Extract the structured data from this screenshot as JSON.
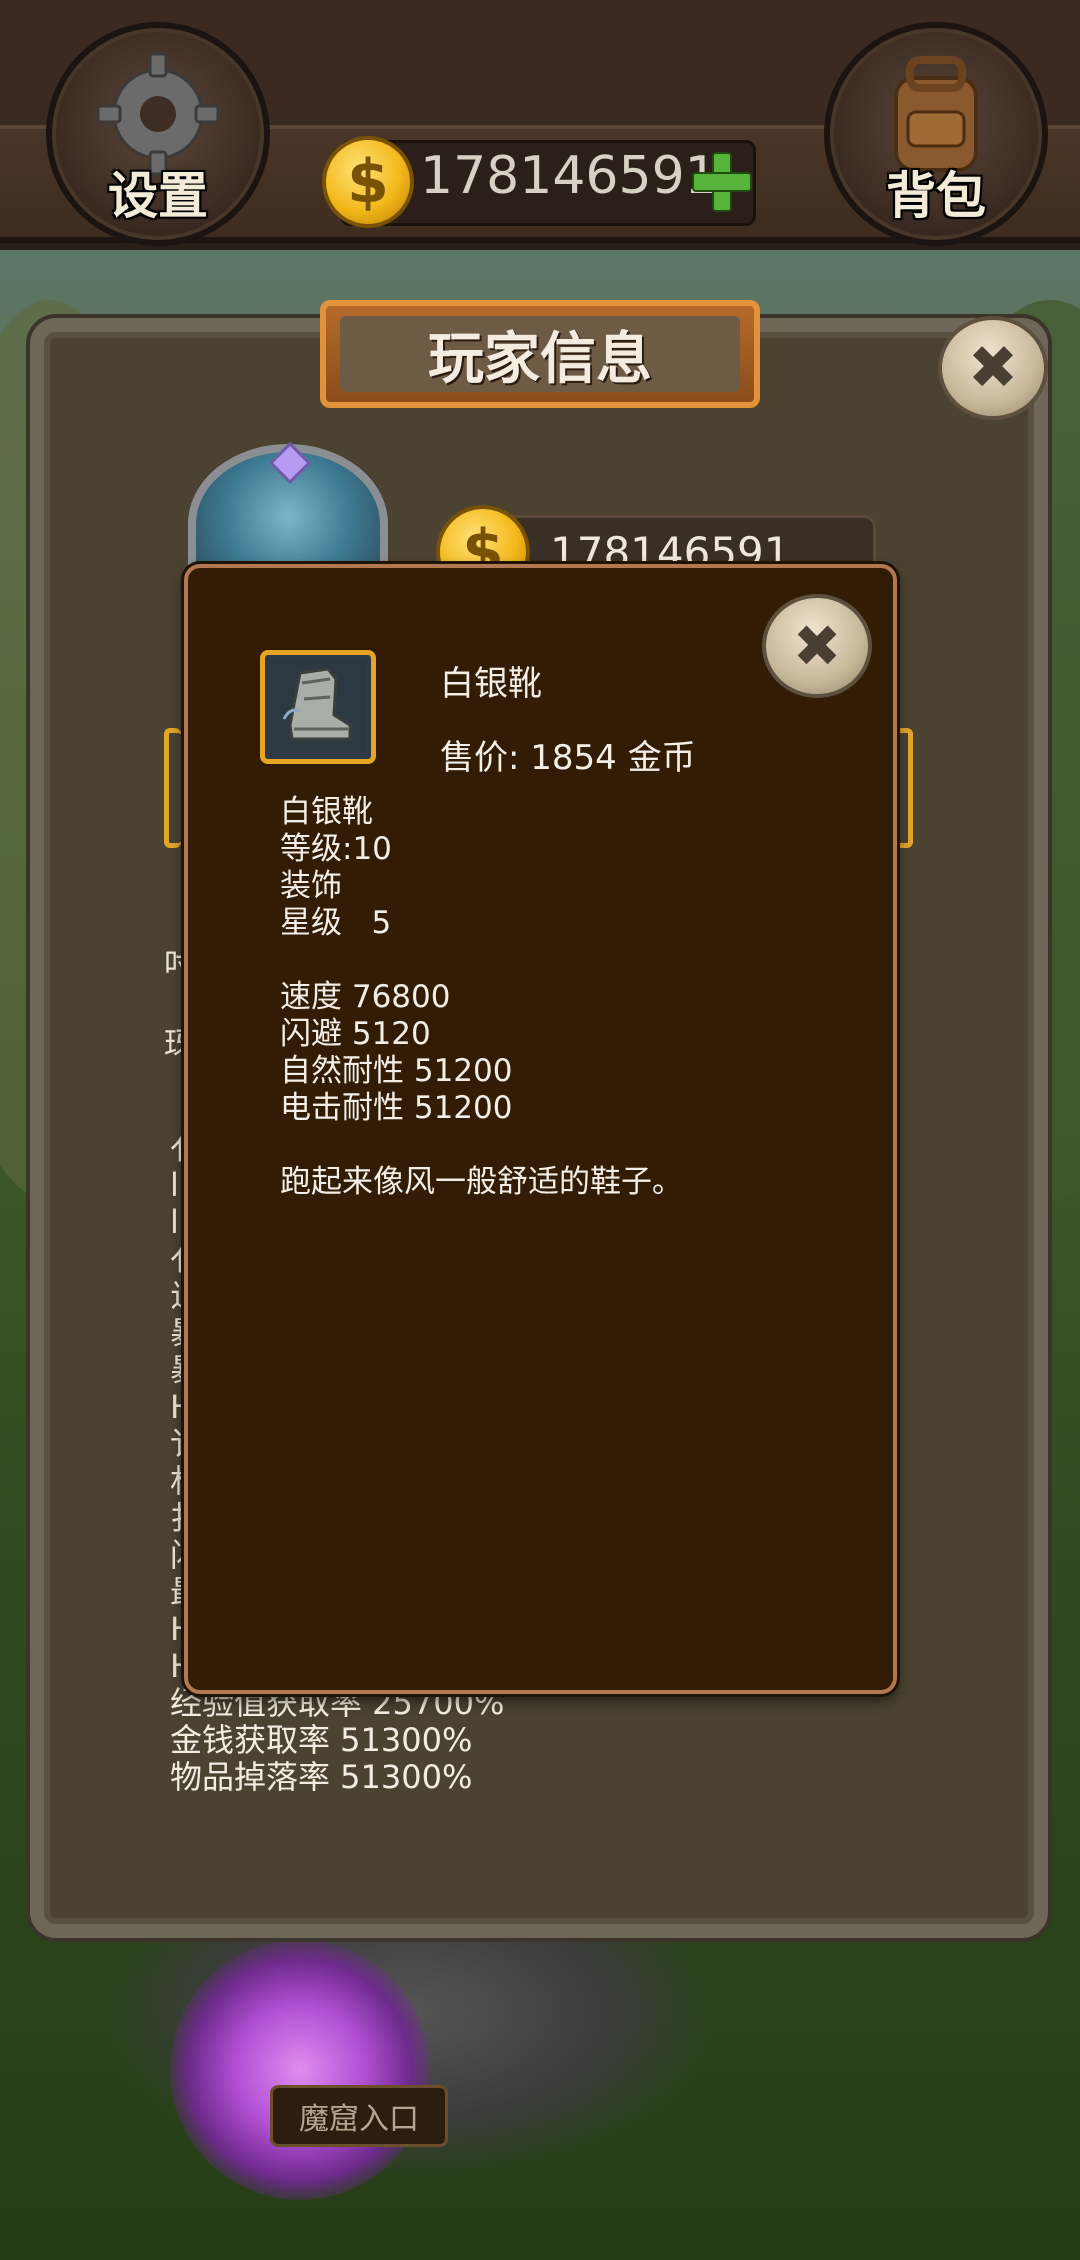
{
  "topbar": {
    "settings_label": "设置",
    "bag_label": "背包",
    "gold": "178146591",
    "icons": [
      "gear-icon",
      "backpack-icon",
      "coin-icon",
      "plus-icon"
    ]
  },
  "player_panel": {
    "title": "玩家信息",
    "gold": "178146591",
    "close_glyph": "✖",
    "stats_visible_tail": [
      "经验值获取率 25700%",
      "金钱获取率 51300%",
      "物品掉落率 51300%"
    ],
    "partial_left_glyphs": [
      "吋",
      "玡",
      "亻",
      "l",
      "l",
      "亻",
      "辶",
      "暴",
      "暴",
      "H",
      "讠",
      "杉",
      "扌",
      "闪",
      "最",
      "H",
      "H"
    ]
  },
  "item_popup": {
    "name": "白银靴",
    "price_text": "售价: 1854 金币",
    "close_glyph": "✖",
    "info": {
      "name": "白银靴",
      "level": "等级:10",
      "type": "装饰",
      "stars": "星级   5"
    },
    "attributes": [
      "速度 76800",
      "闪避 5120",
      "自然耐性 51200",
      "电击耐性 51200"
    ],
    "description": "跑起来像风一般舒适的鞋子。"
  },
  "scene": {
    "cave_label": "魔窟入口"
  },
  "colors": {
    "popup_bg": "#321c06",
    "popup_border": "#b27850",
    "panel_bg": "#4b4232",
    "gold_frame": "#e7a525"
  }
}
